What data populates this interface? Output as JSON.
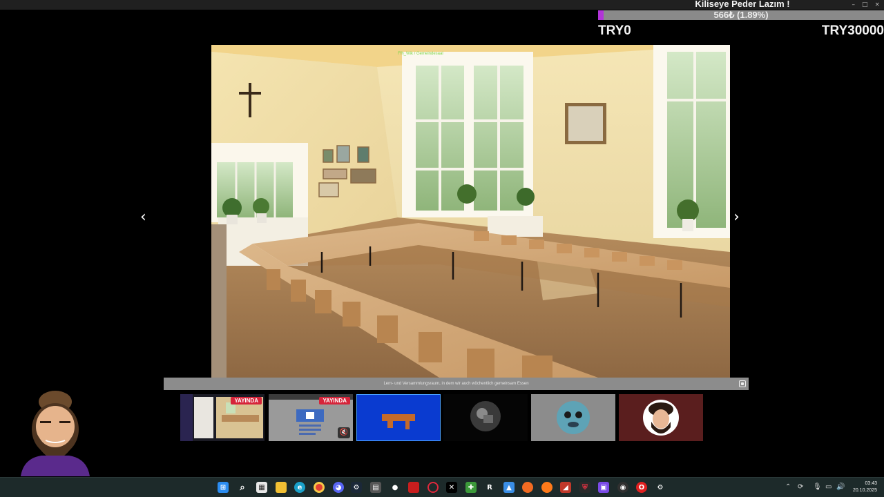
{
  "window": {
    "controls": [
      "–",
      "□",
      "×"
    ]
  },
  "goal": {
    "title": "Kiliseye Peder Lazım !",
    "progress_text": "566₺ (1.89%)",
    "progress_fraction": 0.0189,
    "min_label": "TRY0",
    "max_label": "TRY30000",
    "fill_color": "#b234d8"
  },
  "lightbox": {
    "prev_glyph": "‹",
    "next_glyph": "›",
    "caption": "Lern- und Versammlungsraum, in dem wir auch wöchentlich gemeinsam Essen",
    "overlay_text": "Ffh_Wik / Gemeindesaal"
  },
  "thumbnails": [
    {
      "badge": "YAYINDA"
    },
    {
      "badge": "YAYINDA"
    },
    {},
    {},
    {},
    {}
  ],
  "taskbar": {
    "icons": [
      "windows-start",
      "search",
      "task-view",
      "file-explorer",
      "edge",
      "chrome",
      "discord",
      "steam",
      "app-gray",
      "github",
      "app-red",
      "app-opera-gx",
      "app-x",
      "app-green",
      "r-app",
      "app-blue",
      "app-orange",
      "firefox",
      "app-slides",
      "app-shield",
      "app-purple",
      "app-obs",
      "opera",
      "settings"
    ],
    "clock_time": "03:43",
    "clock_date": "20.10.2025"
  }
}
